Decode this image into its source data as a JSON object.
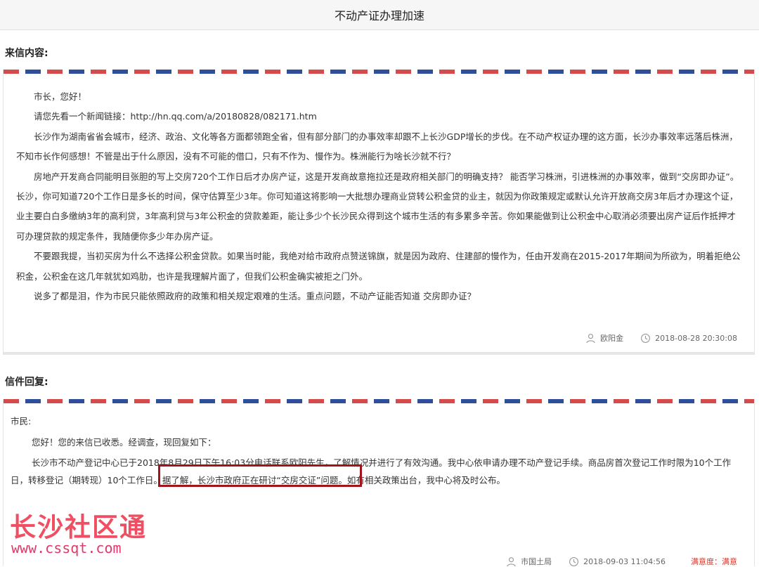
{
  "page": {
    "title": "不动产证办理加速"
  },
  "letter": {
    "section_label": "来信内容:",
    "greeting": "市长，您好！",
    "paragraphs": [
      "请您先看一个新闻链接：http://hn.qq.com/a/20180828/082171.htm",
      "长沙作为湖南省省会城市，经济、政治、文化等各方面都领跑全省，但有部分部门的办事效率却跟不上长沙GDP增长的步伐。在不动产权证办理的这方面，长沙办事效率远落后株洲，不知市长作何感想！不管是出于什么原因，没有不可能的借口，只有不作为、慢作为。株洲能行为啥长沙就不行？",
      "房地产开发商合同能明目张胆的写上交房720个工作日后才办房产证，这是开发商故意拖拉还是政府相关部门的明确支持？ 能否学习株洲，引进株洲的办事效率，做到“交房即办证”。长沙，你可知道720个工作日是多长的时间，保守估算至少3年。你可知道这将影响一大批想办理商业贷转公积金贷的业主，就因为你政策规定或默认允许开放商交房3年后才办理这个证，业主要白白多缴纳3年的高利贷，3年高利贷与3年公积金的贷款差距，能让多少个长沙民众得到这个城市生活的有多累多辛苦。你如果能做到让公积金中心取消必须要出房产证后作抵押才可办理贷款的规定条件，我随便你多少年办房产证。",
      "不要跟我提，当初买房为什么不选择公积金贷款。如果当时能，我绝对给市政府点赞送锦旗，就是因为政府、住建部的慢作为，任由开发商在2015-2017年期间为所欲为，明着拒绝公积金，公积金在这几年就犹如鸡肋，也许是我理解片面了，但我们公积金确实被拒之门外。",
      "说多了都是泪，作为市民只能依照政府的政策和相关规定艰难的生活。重点问题，不动产证能否知道 交房即办证？"
    ],
    "author": "欧阳金",
    "datetime": "2018-08-28 20:30:08"
  },
  "reply": {
    "section_label": "信件回复:",
    "salutation": "市民:",
    "paragraphs": [
      "您好！您的来信已收悉。经调查，现回复如下：",
      "长沙市不动产登记中心已于2018年8月29日下午16:03分电话联系欧阳先生，了解情况并进行了有效沟通。我中心依申请办理不动产登记手续。商品房首次登记工作时限为10个工作日，转移登记（期转现）10个工作日。据了解，长沙市政府正在研讨“交房交证”问题。如有相关政策出台，我中心将及时公布。"
    ],
    "author": "市国土局",
    "datetime": "2018-09-03 11:04:56",
    "satisfaction_label": "满意度：",
    "satisfaction_value": "满意"
  },
  "watermark": {
    "title": "长沙社区通",
    "url": "www.cssqt.com"
  },
  "colors": {
    "airmail_red": "#d54a4a",
    "airmail_blue": "#2f4f9a",
    "highlight_border": "#a0141c",
    "watermark": "#ee4f63",
    "satisfaction": "#d0392b"
  },
  "icons": {
    "author": "user-icon",
    "time": "clock-icon"
  }
}
